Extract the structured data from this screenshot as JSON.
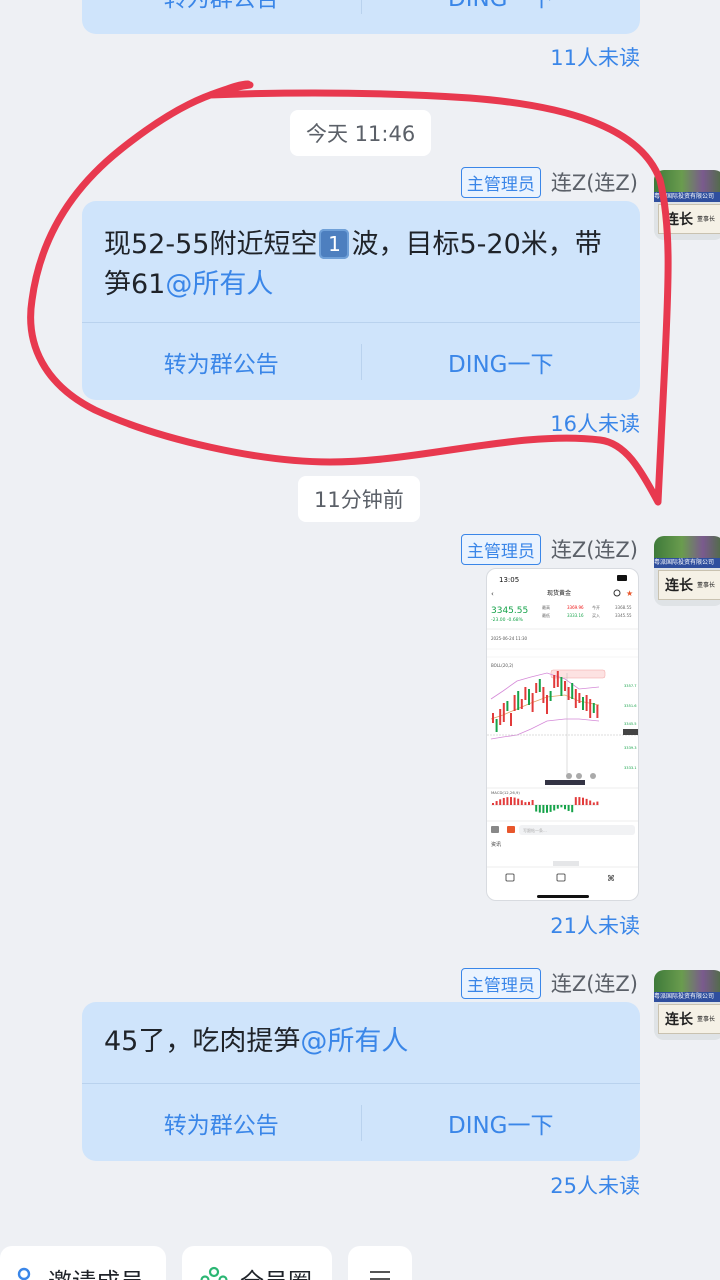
{
  "top_card": {
    "announce_label": "转为群公告",
    "ding_label": "DING一下",
    "read_status": "11人未读"
  },
  "divider_1": "今天 11:46",
  "msg1": {
    "badge": "主管理员",
    "sender": "连Z(连Z)",
    "text_part1": "现52-55附近短空",
    "keycap": "1",
    "text_part2": "波，目标5-20米，带笋61",
    "mention": "@所有人",
    "announce_label": "转为群公告",
    "ding_label": "DING一下",
    "read_status": "16人未读"
  },
  "divider_2": "11分钟前",
  "msg2": {
    "badge": "主管理员",
    "sender": "连Z(连Z)",
    "read_status": "21人未读",
    "screenshot": {
      "time": "13:05",
      "title": "现货黄金",
      "price": "3345.55",
      "change": "-23.00  -0.68%",
      "stats": [
        {
          "label": "最高",
          "value": "3369.96"
        },
        {
          "label": "今开",
          "value": "3368.55"
        },
        {
          "label": "最低",
          "value": "3333.16"
        },
        {
          "label": "买入",
          "value": "3345.55"
        }
      ],
      "date": "2025-06-24 11:30",
      "indicator": "BOLL(20,2)",
      "macd": "MACD(12,26,9)",
      "bottom_label": "资讯",
      "input_placeholder": "写跟帖一条..."
    }
  },
  "msg3": {
    "badge": "主管理员",
    "sender": "连Z(连Z)",
    "text": "45了，吃肉提笋",
    "mention": "@所有人",
    "announce_label": "转为群公告",
    "ding_label": "DING一下",
    "read_status": "25人未读"
  },
  "avatar": {
    "banner": "粤派国际投资有限公司",
    "plate": "连长",
    "plate_sub": "董事长"
  },
  "bottom_bar": {
    "invite_label": "邀请成员",
    "circle_label": "全员圈"
  },
  "colors": {
    "accent": "#3a86e8",
    "bubble": "#cfe4fb",
    "scribble": "#e8394f",
    "background": "#eef0f4"
  }
}
